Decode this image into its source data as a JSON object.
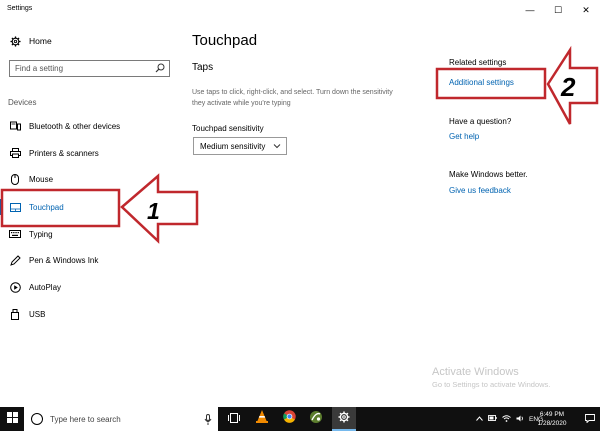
{
  "window": {
    "title": "Settings",
    "minimize_glyph": "—",
    "maximize_glyph": "☐",
    "close_glyph": "✕"
  },
  "sidebar": {
    "home_label": "Home",
    "search_placeholder": "Find a setting",
    "section_label": "Devices",
    "items": [
      {
        "label": "Bluetooth & other devices",
        "icon": "bluetooth-devices-icon"
      },
      {
        "label": "Printers & scanners",
        "icon": "printer-icon"
      },
      {
        "label": "Mouse",
        "icon": "mouse-icon"
      },
      {
        "label": "Touchpad",
        "icon": "touchpad-icon",
        "active": true
      },
      {
        "label": "Typing",
        "icon": "keyboard-icon"
      },
      {
        "label": "Pen & Windows Ink",
        "icon": "pen-icon"
      },
      {
        "label": "AutoPlay",
        "icon": "autoplay-icon"
      },
      {
        "label": "USB",
        "icon": "usb-icon"
      }
    ]
  },
  "main": {
    "title": "Touchpad",
    "taps_heading": "Taps",
    "taps_description_line1": "Use taps to click, right-click, and select. Turn down the sensitivity",
    "taps_description_line2": "they activate while you're typing",
    "sensitivity_label": "Touchpad sensitivity",
    "sensitivity_value": "Medium sensitivity"
  },
  "related": {
    "heading": "Related settings",
    "additional_settings": "Additional settings",
    "question_heading": "Have a question?",
    "get_help": "Get help",
    "better_heading": "Make Windows better.",
    "feedback": "Give us feedback"
  },
  "annotations": {
    "label_1": "1",
    "label_2": "2",
    "color": "#c0282d"
  },
  "watermark": {
    "line1": "Activate Windows",
    "line2": "Go to Settings to activate Windows."
  },
  "taskbar": {
    "search_placeholder": "Type here to search",
    "language": "ENG",
    "time": "6:49 PM",
    "date": "1/28/2020"
  },
  "colors": {
    "accent": "#0063b1",
    "taskbar": "#101010"
  }
}
